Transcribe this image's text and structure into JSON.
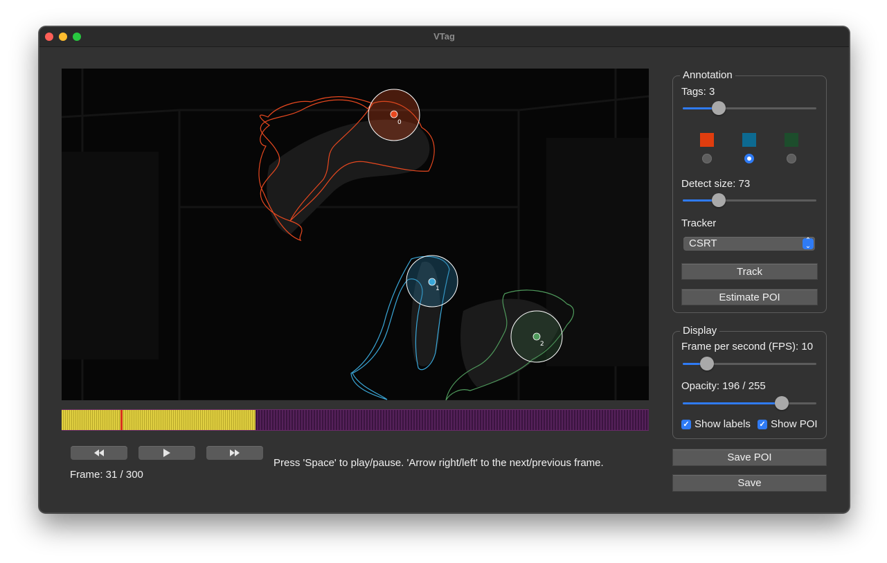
{
  "window": {
    "title": "VTag"
  },
  "video": {
    "tags": [
      {
        "label": "0",
        "color": "#e8481f"
      },
      {
        "label": "1",
        "color": "#3aa7d8"
      },
      {
        "label": "2",
        "color": "#4f9a5c"
      }
    ]
  },
  "timeline": {
    "current_frame": 31,
    "total_frames": 300,
    "tracked_fraction": 0.33
  },
  "playback": {
    "rewind_icon": "rewind-icon",
    "play_icon": "play-icon",
    "forward_icon": "fast-forward-icon",
    "frame_text": "Frame: 31 / 300",
    "hint": "Press 'Space' to play/pause. 'Arrow right/left' to the next/previous frame."
  },
  "annotation": {
    "title": "Annotation",
    "tags_label": "Tags: 3",
    "tags_slider_fraction": 0.27,
    "tag_colors": [
      "#e03d0e",
      "#0d6a91",
      "#1d4d2c"
    ],
    "selected_tag": 1,
    "detect_label": "Detect size: 73",
    "detect_slider_fraction": 0.27,
    "tracker_label": "Tracker",
    "tracker_value": "CSRT",
    "track_button": "Track",
    "estimate_button": "Estimate POI"
  },
  "display": {
    "title": "Display",
    "fps_label": "Frame per second (FPS): 10",
    "fps_slider_fraction": 0.18,
    "opacity_label": "Opacity: 196 / 255",
    "opacity_slider_fraction": 0.74,
    "show_labels": "Show labels",
    "show_poi": "Show POI",
    "show_labels_checked": true,
    "show_poi_checked": true
  },
  "actions": {
    "save_poi": "Save POI",
    "save": "Save"
  },
  "colors": {
    "accent": "#2f7bf5",
    "background": "#323232"
  }
}
